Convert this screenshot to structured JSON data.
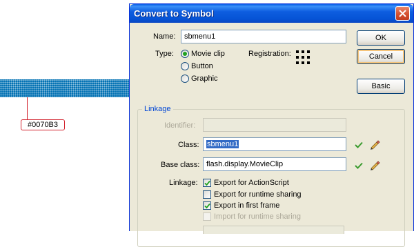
{
  "annotation": {
    "color_label": "#0070B3",
    "stripe_color": "#0070b3"
  },
  "dialog": {
    "title": "Convert to Symbol",
    "name_label": "Name:",
    "name_value": "sbmenu1",
    "type_label": "Type:",
    "type_options": [
      "Movie clip",
      "Button",
      "Graphic"
    ],
    "type_selected": "Movie clip",
    "registration_label": "Registration:",
    "buttons": {
      "ok": "OK",
      "cancel": "Cancel",
      "basic": "Basic"
    },
    "linkage": {
      "group_title": "Linkage",
      "identifier_label": "Identifier:",
      "identifier_value": "",
      "class_label": "Class:",
      "class_value": "sbmenu1",
      "base_class_label": "Base class:",
      "base_class_value": "flash.display.MovieClip",
      "linkage_label": "Linkage:",
      "options": [
        {
          "label": "Export for ActionScript",
          "checked": true,
          "enabled": true
        },
        {
          "label": "Export for runtime sharing",
          "checked": false,
          "enabled": true
        },
        {
          "label": "Export in first frame",
          "checked": true,
          "enabled": true
        },
        {
          "label": "Import for runtime sharing",
          "checked": false,
          "enabled": false
        }
      ]
    }
  }
}
